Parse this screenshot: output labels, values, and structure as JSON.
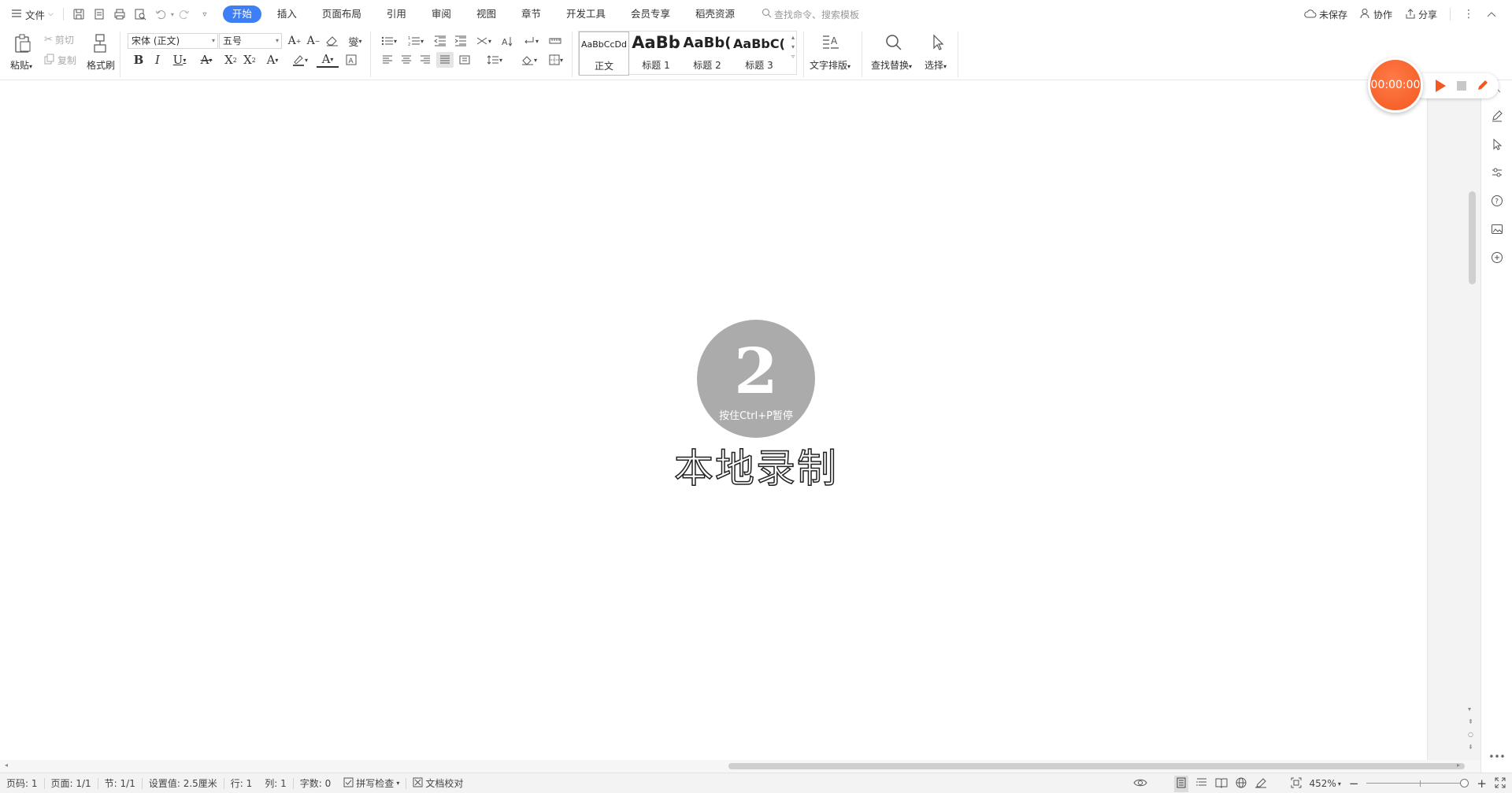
{
  "menubar": {
    "file_label": "文件",
    "tabs": [
      {
        "label": "开始",
        "active": true
      },
      {
        "label": "插入"
      },
      {
        "label": "页面布局"
      },
      {
        "label": "引用"
      },
      {
        "label": "审阅"
      },
      {
        "label": "视图"
      },
      {
        "label": "章节"
      },
      {
        "label": "开发工具"
      },
      {
        "label": "会员专享"
      },
      {
        "label": "稻壳资源"
      }
    ],
    "search_placeholder": "查找命令、搜索模板",
    "unsaved_label": "未保存",
    "collab_label": "协作",
    "share_label": "分享"
  },
  "ribbon": {
    "paste_label": "粘贴",
    "cut_label": "剪切",
    "copy_label": "复制",
    "format_painter_label": "格式刷",
    "font_name": "宋体 (正文)",
    "font_size": "五号",
    "styles": [
      {
        "sample": "AaBbCcDd",
        "name": "正文"
      },
      {
        "sample": "AaBb",
        "name": "标题 1"
      },
      {
        "sample": "AaBb(",
        "name": "标题 2"
      },
      {
        "sample": "AaBbC(",
        "name": "标题 3"
      }
    ],
    "text_layout_label": "文字排版",
    "find_replace_label": "查找替换",
    "select_label": "选择"
  },
  "recorder": {
    "timer": "00:00:00",
    "countdown_number": "2",
    "countdown_hint": "按住Ctrl+P暂停",
    "title": "本地录制",
    "accent": "#f4571f"
  },
  "statusbar": {
    "page_num": "页码: 1",
    "pages": "页面: 1/1",
    "section": "节: 1/1",
    "setting": "设置值: 2.5厘米",
    "row": "行: 1",
    "col": "列: 1",
    "word_count": "字数: 0",
    "spell_check": "拼写检查",
    "doc_proof": "文档校对",
    "zoom": "452%"
  },
  "colors": {
    "accent": "#3e7ef7",
    "recorder": "#f4571f"
  }
}
